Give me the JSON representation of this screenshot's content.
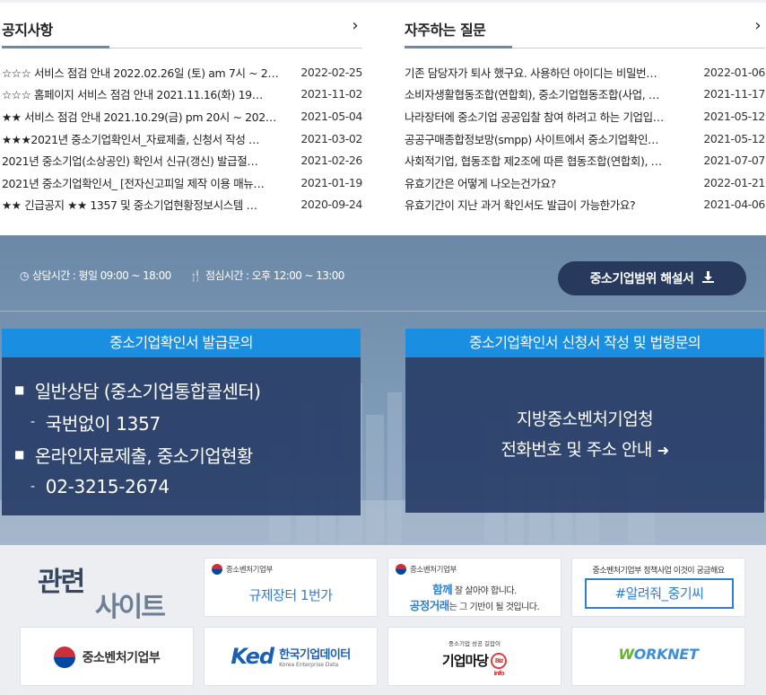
{
  "notice": {
    "title": "공지사항",
    "more_icon": "chevron-right-icon",
    "items": [
      {
        "title": "☆☆☆ 서비스 점검 안내 2022.02.26일 (토) am 7시 ~ 2…",
        "date": "2022-02-25"
      },
      {
        "title": "☆☆☆ 홈페이지 서비스 점검 안내 2021.11.16(화) 19…",
        "date": "2021-11-02"
      },
      {
        "title": "★★ 서비스 점검 안내 2021.10.29(금) pm 20시 ~ 202…",
        "date": "2021-05-04"
      },
      {
        "title": "★★★2021년 중소기업확인서_자료제출, 신청서 작성 …",
        "date": "2021-03-02"
      },
      {
        "title": "2021년 중소기업(소상공인) 확인서 신규(갱신) 발급절…",
        "date": "2021-02-26"
      },
      {
        "title": "2021년 중소기업확인서_ [전자신고피일 제작 이용 매뉴…",
        "date": "2021-01-19"
      },
      {
        "title": "★★ 긴급공지 ★★ 1357 및 중소기업현황정보시스템 …",
        "date": "2020-09-24"
      }
    ]
  },
  "faq": {
    "title": "자주하는 질문",
    "more_icon": "chevron-right-icon",
    "items": [
      {
        "title": "기존 담당자가 퇴사 했구요. 사용하던 아이디는 비밀번…",
        "date": "2022-01-06"
      },
      {
        "title": "소비자생활협동조합(연합회), 중소기업협동조합(사업, …",
        "date": "2021-11-17"
      },
      {
        "title": "나라장터에 중소기업 공공입찰 참여 하려고 하는 기업입…",
        "date": "2021-05-12"
      },
      {
        "title": "공공구매종합정보망(smpp) 사이트에서 중소기업확인…",
        "date": "2021-05-12"
      },
      {
        "title": "사회적기업, 협동조합 제2조에 따른 협동조합(연합회), …",
        "date": "2021-07-07"
      },
      {
        "title": "유효기간은 어떻게 나오는건가요?",
        "date": "2022-01-21"
      },
      {
        "title": "유효기간이 지난 과거 확인서도 발급이 가능한가요?",
        "date": "2021-04-06"
      }
    ]
  },
  "consult": {
    "hours_icon": "clock-icon",
    "hours": "상담시간 : 평일 09:00 ~ 18:00",
    "lunch_icon": "cutlery-icon",
    "lunch": "점심시간 : 오후 12:00 ~ 13:00",
    "guide_button": "중소기업범위 해설서",
    "guide_icon": "download-icon",
    "panel1": {
      "title": "중소기업확인서 발급문의",
      "line1": "일반상담 (중소기업통합콜센터)",
      "line1_sub": "국번없이 1357",
      "line2": "온라인자료제출, 중소기업현황",
      "line2_sub": "02-3215-2674"
    },
    "panel2": {
      "title": "중소기업확인서 신청서 작성 및 법령문의",
      "line1": "지방중소벤처기업청",
      "line2": "전화번호 및 주소 안내",
      "icon": "sign-in-icon"
    }
  },
  "related": {
    "title_a": "관련",
    "title_b": "사이트",
    "sites": {
      "regulation": {
        "org": "중소벤처기업부",
        "label": "규제장터 1번가"
      },
      "fairtrade": {
        "org": "중소벤처기업부",
        "hl1": "함께",
        "l1": " 잘 살아야 합니다.",
        "hl2": "공정거래",
        "l2": "는 그 기반이 될 것입니다."
      },
      "tellme": {
        "caption": "중소벤처기업부 정책사업 이것이 궁금해요",
        "label": "#알려줘_중기씨"
      },
      "mss": {
        "label": "중소벤처기업부"
      },
      "ked": {
        "mark": "Ked",
        "kr": "한국기업데이터",
        "en": "Korea Enterprise Data"
      },
      "bizinfo": {
        "small": "중소기업 성공 길잡이",
        "label": "기업마당",
        "badge": "Biz info"
      },
      "worknet": {
        "w": "W",
        "rest": "ORKNET"
      }
    }
  }
}
